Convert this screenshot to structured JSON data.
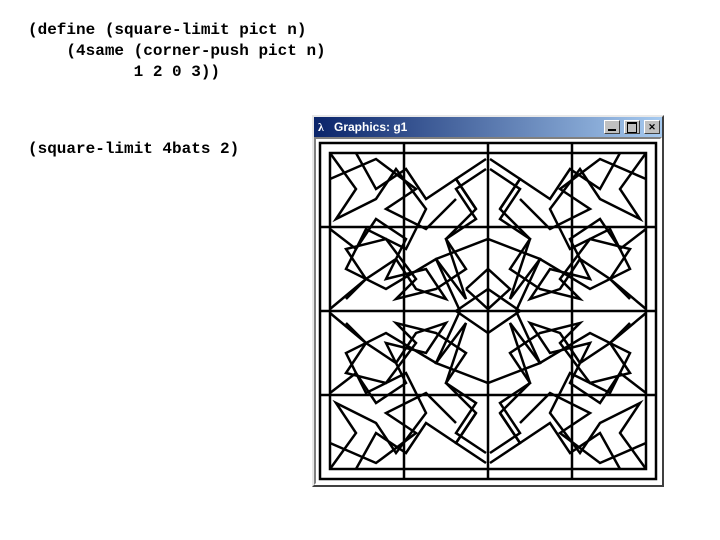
{
  "code": {
    "line1": "(define (square-limit pict n)",
    "line2": "    (4same (corner-push pict n)",
    "line3": "           1 2 0 3))"
  },
  "call": "(square-limit 4bats 2)",
  "window": {
    "title": "Graphics: g1",
    "icon_name": "lambda-icon"
  }
}
